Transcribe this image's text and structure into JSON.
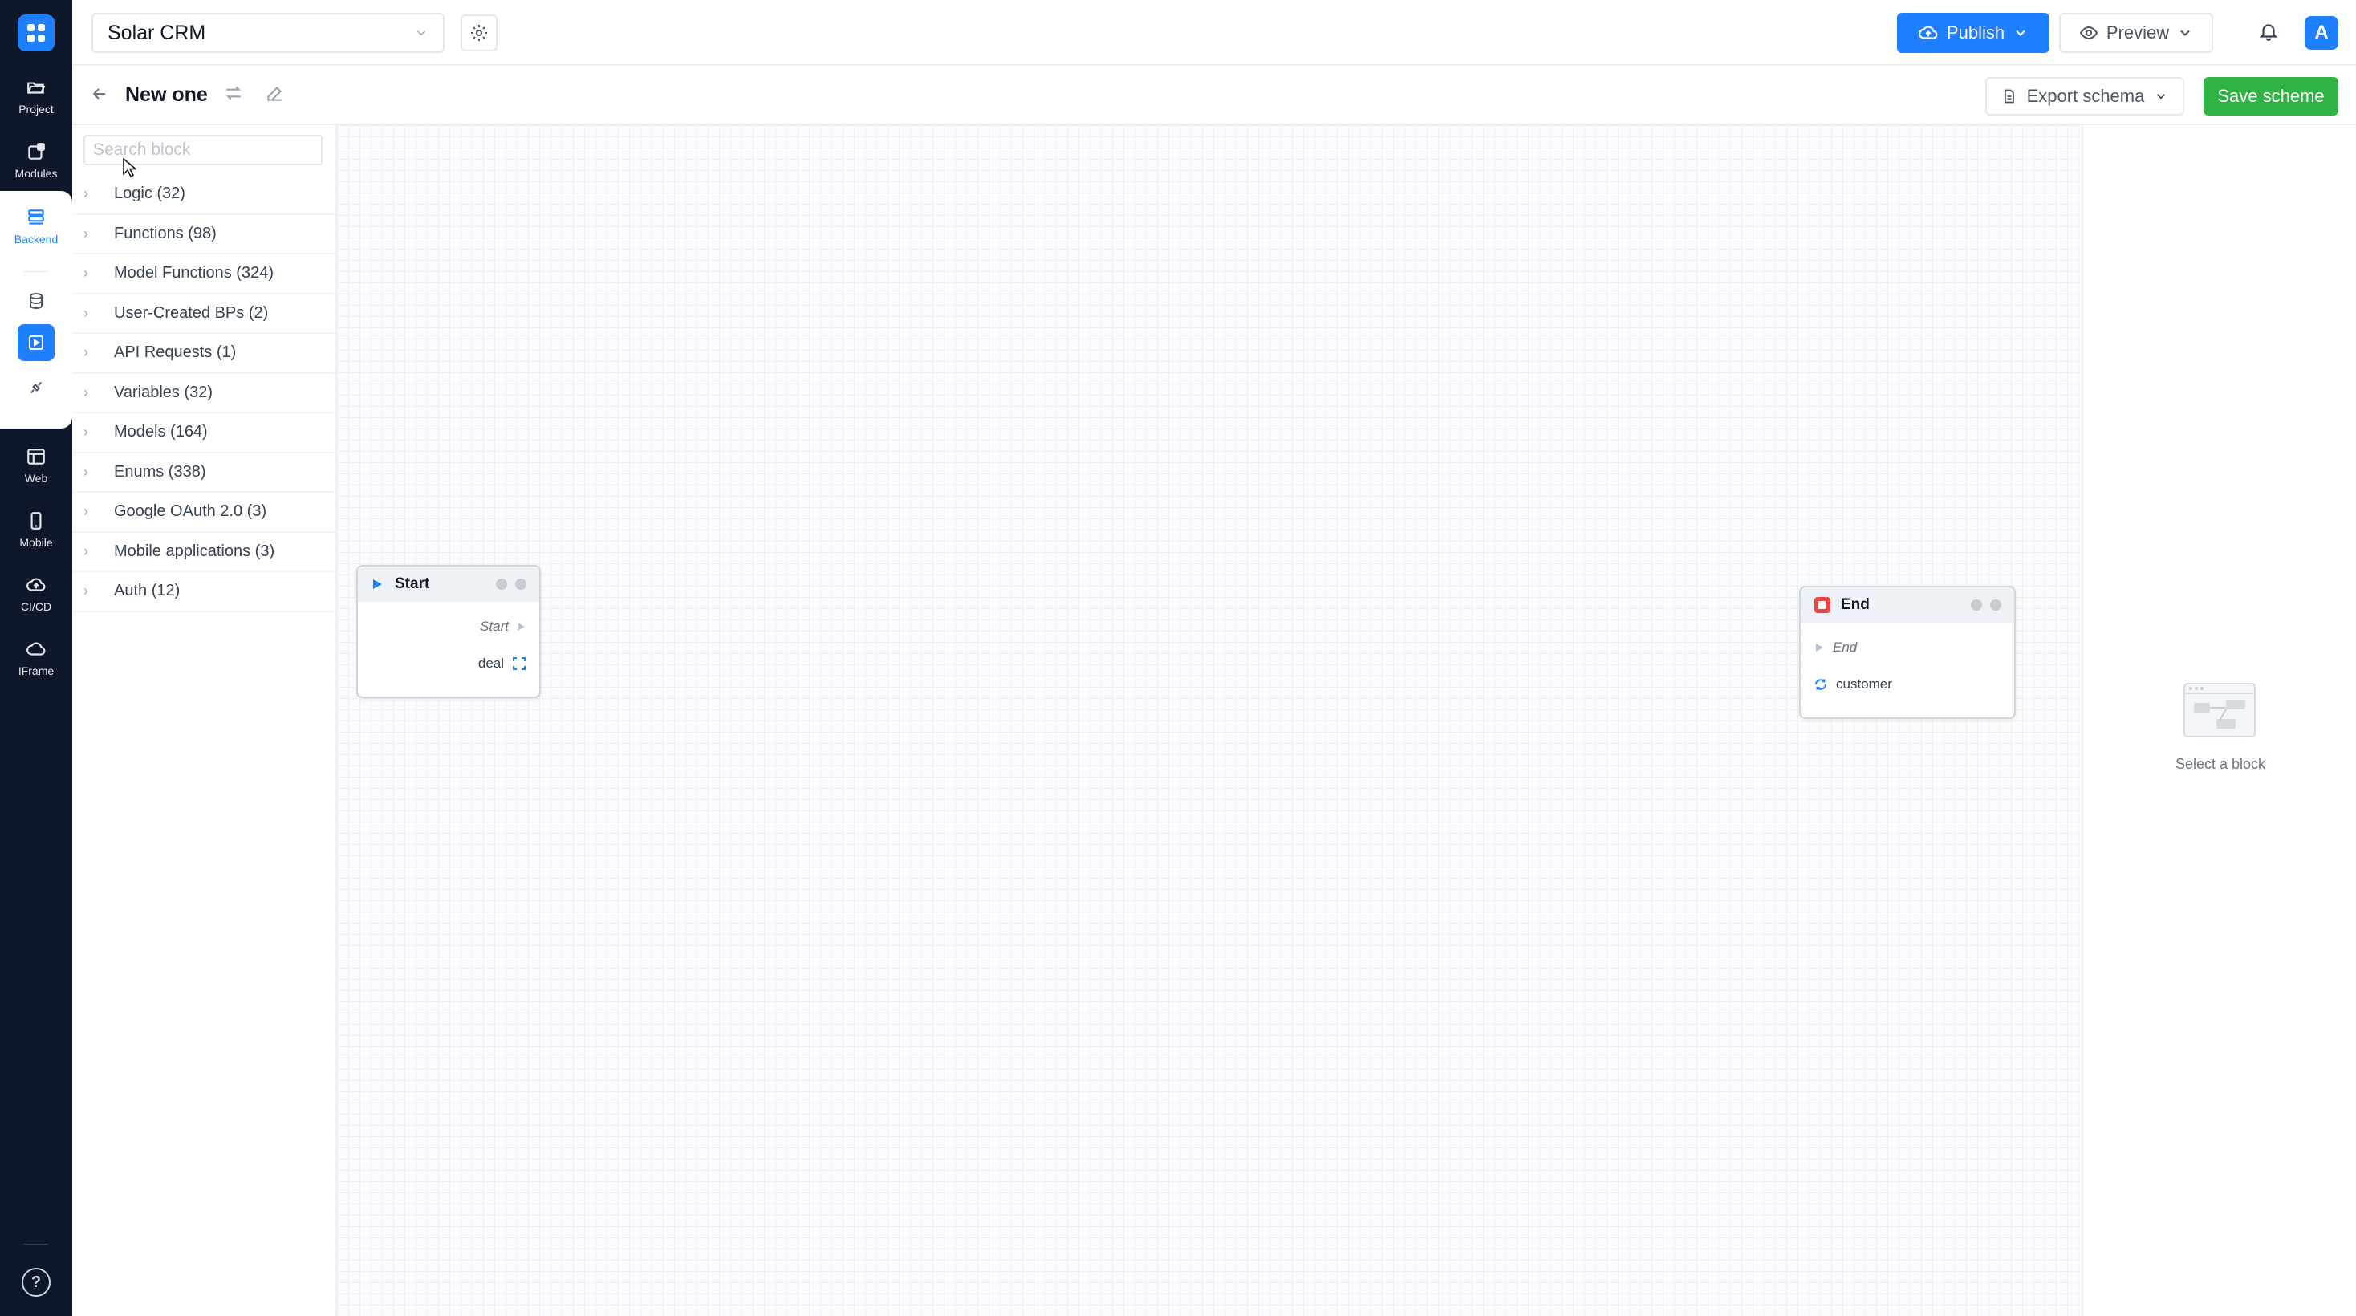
{
  "rail": {
    "items": [
      {
        "label": "Project",
        "icon": "folder-open-icon"
      },
      {
        "label": "Modules",
        "icon": "modules-icon"
      },
      {
        "label": "Backend",
        "icon": "server-icon"
      },
      {
        "label": "Web",
        "icon": "browser-icon"
      },
      {
        "label": "Mobile",
        "icon": "mobile-icon"
      },
      {
        "label": "CI/CD",
        "icon": "cloud-upload-icon"
      },
      {
        "label": "IFrame",
        "icon": "cloud-icon"
      }
    ],
    "sub_icons": [
      "database-icon",
      "play-square-icon",
      "plug-icon"
    ],
    "active": "Backend",
    "accent": "#1e80ff"
  },
  "topbar": {
    "project_name": "Solar CRM",
    "publish_label": "Publish",
    "preview_label": "Preview",
    "avatar_letter": "A"
  },
  "subheader": {
    "title": "New one",
    "export_label": "Export schema",
    "save_label": "Save scheme",
    "save_color": "#2fb344"
  },
  "panel": {
    "search_placeholder": "Search block",
    "categories": [
      "Logic (32)",
      "Functions (98)",
      "Model Functions (324)",
      "User-Created BPs (2)",
      "API Requests (1)",
      "Variables (32)",
      "Models (164)",
      "Enums (338)",
      "Google OAuth 2.0 (3)",
      "Mobile applications (3)",
      "Auth (12)"
    ]
  },
  "nodes": {
    "start": {
      "title": "Start",
      "flow_output": "Start",
      "param": "deal"
    },
    "end": {
      "title": "End",
      "flow_input": "End",
      "param": "customer"
    }
  },
  "right_panel": {
    "empty_text": "Select a block"
  }
}
